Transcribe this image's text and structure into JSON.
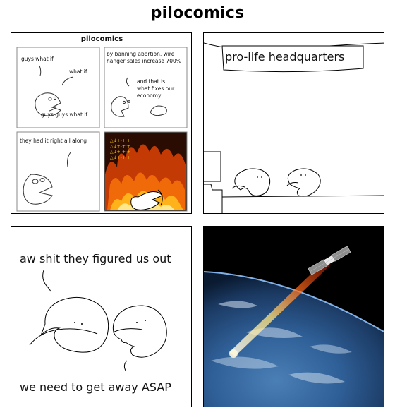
{
  "page_title": "pilocomics",
  "panel1": {
    "title": "pilocomics",
    "sub1": {
      "line1": "guys what if",
      "line2": "what if",
      "line3": "guys guys what if"
    },
    "sub2": {
      "line1": "by banning abortion, wire",
      "line2": "hanger sales increase 700%",
      "line3": "and that is",
      "line4": "what fixes our",
      "line5": "economy"
    },
    "sub3": {
      "line1": "they had it right all along"
    }
  },
  "panel2": {
    "sign": "pro-life headquarters"
  },
  "panel3": {
    "top_text": "aw shit they figured us out",
    "bottom_text": "we need to get away ASAP"
  }
}
